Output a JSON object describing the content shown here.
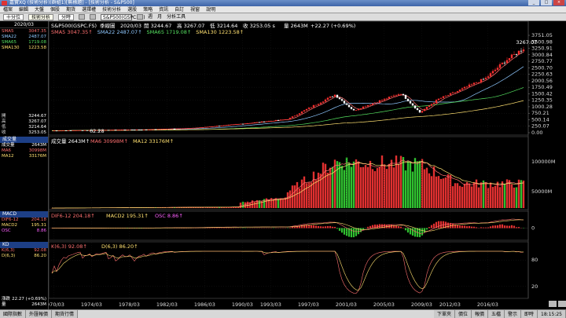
{
  "window": {
    "title": "嘉實XQ (技術分析)(群組1)[無標題] - [技術分析 - S&P500]",
    "buttons": [
      "_",
      "□",
      "×"
    ]
  },
  "menu": [
    "檔案",
    "編輯",
    "大盤",
    "個股",
    "期貨",
    "選擇權",
    "技術分析",
    "選股",
    "策略",
    "資訊",
    "自訂",
    "視窗",
    "說明"
  ],
  "toolbar": {
    "tabs": [
      "十分位",
      "技術分析",
      "分時"
    ],
    "symbol": "S&P500(GSPC.FS)",
    "actions": [
      "週",
      "月",
      "分析工具"
    ]
  },
  "sidebar": {
    "date": "2020/03",
    "ohlc": [
      {
        "k": "開",
        "v": "3244.67"
      },
      {
        "k": "高",
        "v": "3267.07"
      },
      {
        "k": "低",
        "v": "3214.64"
      },
      {
        "k": "收",
        "v": "3253.05"
      }
    ],
    "ma": [
      {
        "k": "SMA5",
        "v": "3047.35"
      },
      {
        "k": "SMA22",
        "v": "2487.07"
      },
      {
        "k": "SMA65",
        "v": "1719.08"
      },
      {
        "k": "SMA130",
        "v": "1223.58"
      }
    ],
    "vol": {
      "title": "成交量",
      "rows": [
        {
          "k": "成交量",
          "v": "2643M"
        },
        {
          "k": "MA6",
          "v": "30998M"
        },
        {
          "k": "MA12",
          "v": "33176M"
        }
      ]
    },
    "macd": {
      "title": "MACD",
      "rows": [
        {
          "k": "DIF6-12",
          "v": "204.18"
        },
        {
          "k": "MACD2",
          "v": "195.31"
        },
        {
          "k": "OSC",
          "v": "8.86"
        }
      ]
    },
    "kd": {
      "title": "KD",
      "rows": [
        {
          "k": "K(6,3)",
          "v": "92.08"
        },
        {
          "k": "D(6,3)",
          "v": "86.20"
        }
      ]
    },
    "bottom": [
      {
        "k": "漲跌",
        "v": "22.27 (+0.69%)"
      },
      {
        "k": "量",
        "v": "2643M"
      }
    ]
  },
  "price_header": {
    "symbol": "S&P500(GSPC.FS)",
    "kind": "季線圖",
    "date": "2020/03",
    "open": "開 3244.67",
    "high": "高 3267.07",
    "low": "低 3214.64",
    "close": "收 3253.05 s",
    "vol": "量 2643M",
    "chg": "+22.27 (+0.69%)"
  },
  "ma_legend": [
    {
      "label": "SMA5 3047.35",
      "color": "#ff7070"
    },
    {
      "label": "SMA22 2487.07",
      "color": "#8fc8ff"
    },
    {
      "label": "SMA65 1719.08",
      "color": "#55e060"
    },
    {
      "label": "SMA130 1223.58",
      "color": "#ffe070"
    }
  ],
  "vol_legend": [
    {
      "label": "成交量 2643M",
      "color": "#ffffff"
    },
    {
      "label": "MA6 30998M",
      "color": "#ff7070"
    },
    {
      "label": "MA12 33176M",
      "color": "#ffe070"
    }
  ],
  "macd_legend": [
    {
      "label": "DIF6-12 204.18",
      "color": "#ff7070"
    },
    {
      "label": "MACD2 195.31",
      "color": "#ffe070"
    },
    {
      "label": "OSC 8.86",
      "color": "#ff60ff"
    }
  ],
  "kd_legend": [
    {
      "label": "K(6,3) 92.08",
      "color": "#ff7070"
    },
    {
      "label": "D(6,3) 86.20",
      "color": "#ffe070"
    }
  ],
  "annotations": {
    "high_label": "3267.07",
    "low_label": "62.28"
  },
  "chart_data": {
    "type": "candlestick",
    "price_axis": [
      3751.05,
      3500.98,
      3250.91,
      3000.84,
      2750.77,
      2500.7,
      2250.63,
      2000.56,
      1750.49,
      1500.42,
      1250.35,
      1000.28,
      750.21,
      500.14,
      250.07,
      0.0
    ],
    "volume_axis": [
      "100000M",
      "50000M"
    ],
    "macd_axis": [
      0
    ],
    "kd_axis": [
      80,
      20
    ],
    "x_labels": [
      "1970/03",
      "1974/03",
      "1978/03",
      "1982/03",
      "1986/03",
      "1990/03",
      "1993/03",
      "1997/03",
      "2001/03",
      "2005/03",
      "2009/03",
      "2012/03",
      "2016/03"
    ],
    "price_anchors": [
      [
        1970,
        80
      ],
      [
        1974,
        95
      ],
      [
        1980,
        120
      ],
      [
        1985,
        180
      ],
      [
        1990,
        340
      ],
      [
        1995,
        520
      ],
      [
        1997,
        900
      ],
      [
        2000,
        1460
      ],
      [
        2002,
        850
      ],
      [
        2003,
        1000
      ],
      [
        2007,
        1520
      ],
      [
        2009,
        780
      ],
      [
        2011,
        1300
      ],
      [
        2013,
        1600
      ],
      [
        2016,
        2100
      ],
      [
        2018,
        2750
      ],
      [
        2019,
        3000
      ],
      [
        2020,
        3253
      ]
    ],
    "start_year": 1970,
    "end_year": 2020,
    "ylim": [
      0,
      3751.05
    ]
  },
  "status": {
    "left": [
      "國際指數",
      "外匯報價",
      "期貨行情"
    ],
    "right": [
      "下單夾",
      "價位",
      "報價",
      "五檔",
      "警示",
      "即時",
      "18:15:25"
    ]
  }
}
